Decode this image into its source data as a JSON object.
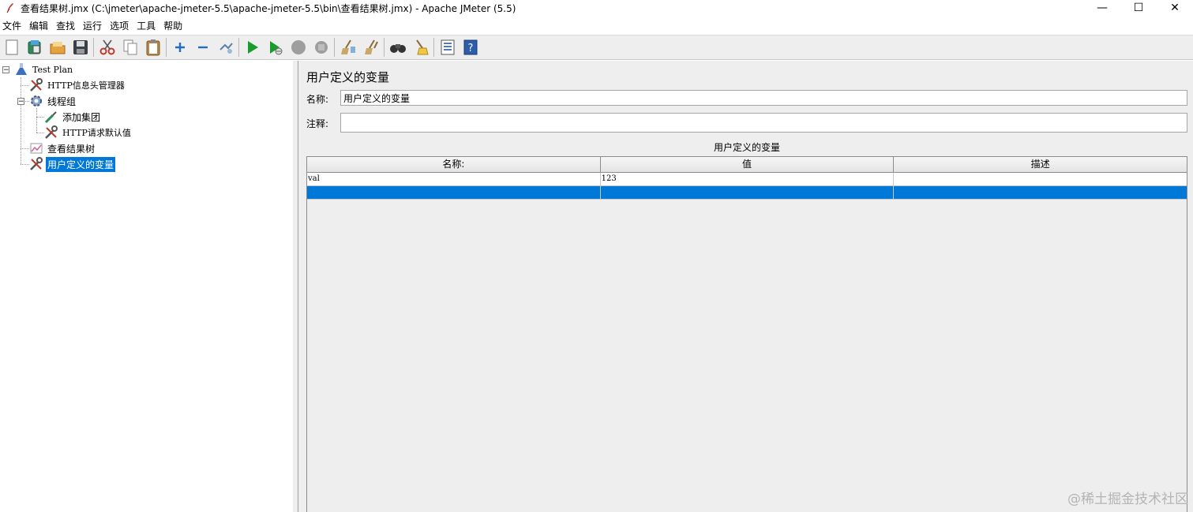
{
  "window": {
    "title": "查看结果树.jmx (C:\\jmeter\\apache-jmeter-5.5\\apache-jmeter-5.5\\bin\\查看结果树.jmx) - Apache JMeter (5.5)",
    "minimize": "—",
    "maximize": "☐",
    "close": "✕"
  },
  "menu": [
    "文件",
    "编辑",
    "查找",
    "运行",
    "选项",
    "工具",
    "帮助"
  ],
  "toolbar_icons": [
    "new-icon",
    "templates-icon",
    "open-icon",
    "save-icon",
    "cut-icon",
    "copy-icon",
    "paste-icon",
    "expand-icon",
    "collapse-icon",
    "toggle-icon",
    "start-icon",
    "start-no-pause-icon",
    "stop-icon",
    "shutdown-icon",
    "clear-icon",
    "clear-all-icon",
    "search-icon",
    "reset-search-icon",
    "function-helper-icon",
    "help-icon"
  ],
  "tree": {
    "items": [
      {
        "label": "Test Plan"
      },
      {
        "label": "HTTP信息头管理器"
      },
      {
        "label": "线程组"
      },
      {
        "label": "添加集团"
      },
      {
        "label": "HTTP请求默认值"
      },
      {
        "label": "查看结果树"
      },
      {
        "label": "用户定义的变量"
      }
    ],
    "toggle_collapse": "−"
  },
  "panel": {
    "heading": "用户定义的变量",
    "name_label": "名称:",
    "name_value": "用户定义的变量",
    "comment_label": "注释:",
    "comment_value": "",
    "table_caption": "用户定义的变量"
  },
  "table": {
    "columns": [
      "名称:",
      "值",
      "描述"
    ],
    "rows": [
      [
        "val",
        "123",
        ""
      ],
      [
        "",
        "",
        ""
      ]
    ],
    "selected_row": 1
  },
  "watermark": "@稀土掘金技术社区",
  "colors": {
    "selection": "#0078d7",
    "panel_bg": "#eeeeee",
    "start_green": "#1a9c2c"
  }
}
